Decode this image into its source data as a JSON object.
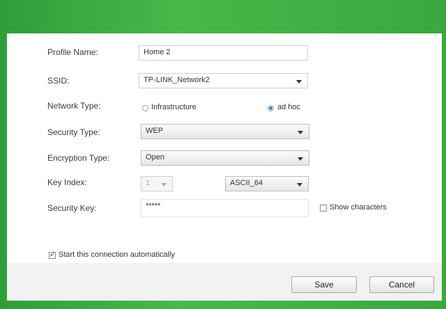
{
  "form": {
    "profile_name_label": "Profile Name:",
    "profile_name_value": "Home 2",
    "ssid_label": "SSID:",
    "ssid_value": "TP-LINK_Network2",
    "network_type_label": "Network Type:",
    "network_type_options": [
      "Infrastructure",
      "ad hoc"
    ],
    "network_type_selected": "ad hoc",
    "security_type_label": "Security Type:",
    "security_type_value": "WEP",
    "encryption_type_label": "Encryption Type:",
    "encryption_type_value": "Open",
    "key_index_label": "Key Index:",
    "key_index_value": "1",
    "key_format_value": "ASCII_64",
    "security_key_label": "Security Key:",
    "security_key_value": "*****",
    "show_characters_label": "Show characters",
    "show_characters_checked": false,
    "auto_connect_label": "Start this connection automatically",
    "auto_connect_checked": true
  },
  "buttons": {
    "save": "Save",
    "cancel": "Cancel"
  },
  "colors": {
    "frame_green": "#3aa83f",
    "radio_selected": "#2b7fd0"
  }
}
